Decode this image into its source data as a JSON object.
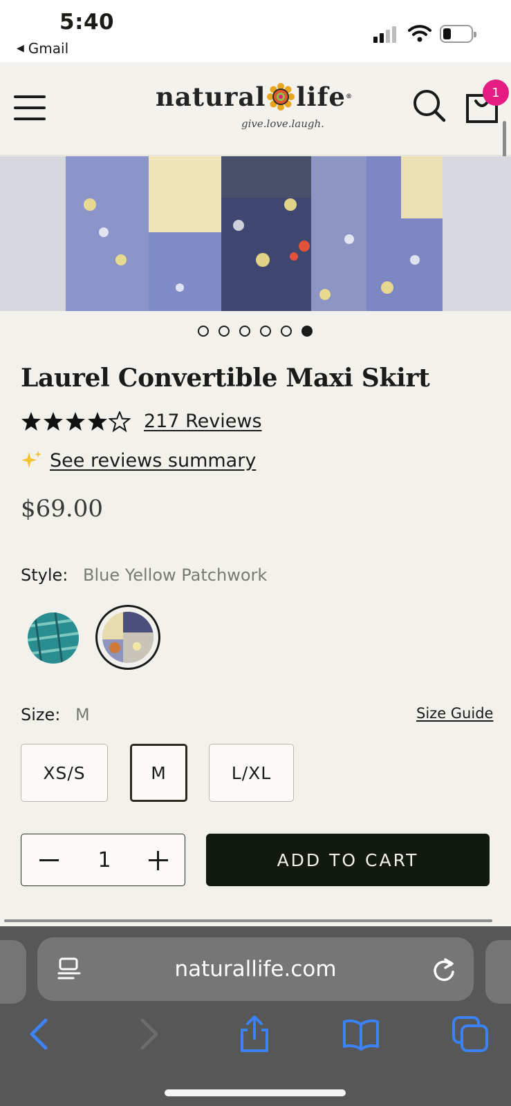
{
  "status_bar": {
    "time": "5:40",
    "back_app": "Gmail"
  },
  "header": {
    "brand_left": "natural",
    "brand_right": "life",
    "tagline": "give.love.laugh.",
    "cart_count": "1"
  },
  "carousel": {
    "slide_count": 6,
    "active_index": 5
  },
  "product": {
    "title": "Laurel Convertible Maxi Skirt",
    "rating": 4.5,
    "reviews_text": "217 Reviews",
    "summary_text": "See reviews summary",
    "price": "$69.00"
  },
  "style": {
    "label": "Style:",
    "value": "Blue Yellow Patchwork"
  },
  "size": {
    "label": "Size:",
    "value": "M",
    "guide": "Size Guide",
    "options": [
      "XS/S",
      "M",
      "L/XL"
    ],
    "selected": "M"
  },
  "quantity": {
    "value": "1"
  },
  "add_to_cart": "ADD TO CART",
  "browser": {
    "url": "naturallife.com"
  },
  "colors": {
    "accent_badge": "#e51d82",
    "cta_background": "#121a10",
    "page_background": "#f3f1eb",
    "ios_blue": "#3b82f6"
  }
}
